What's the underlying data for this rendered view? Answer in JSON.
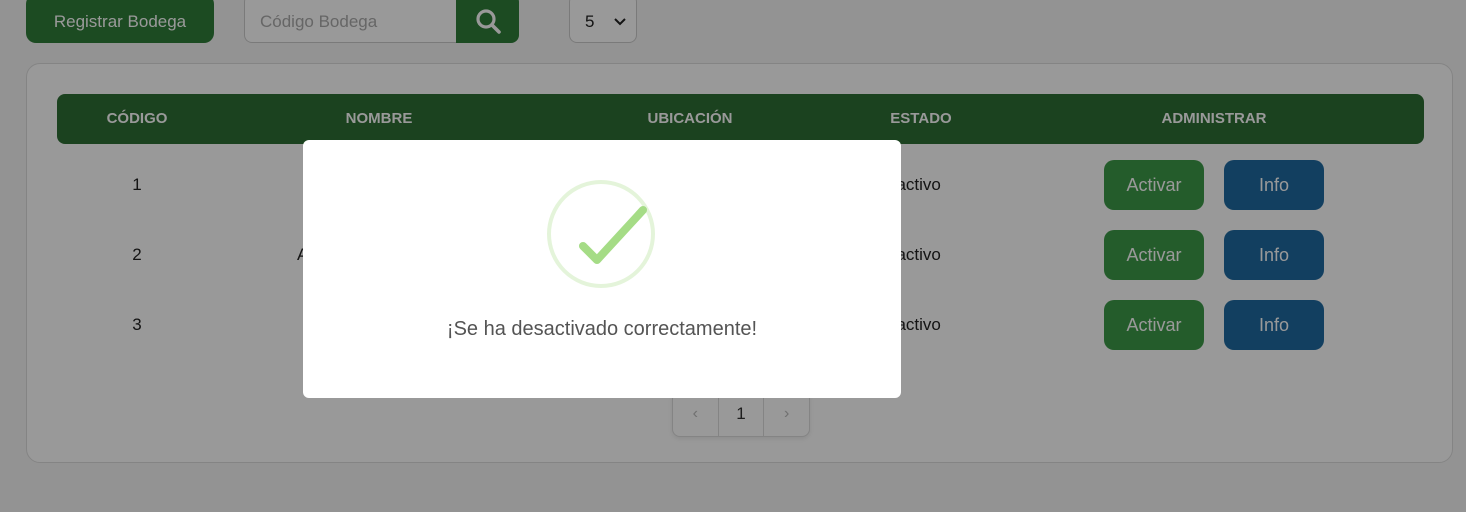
{
  "toolbar": {
    "register_label": "Registrar Bodega",
    "search_placeholder": "Código Bodega",
    "page_size_value": "5"
  },
  "table": {
    "headers": [
      "CÓDIGO",
      "NOMBRE",
      "UBICACIÓN",
      "ESTADO",
      "ADMINISTRAR"
    ],
    "rows": [
      {
        "codigo": "1",
        "nombre": "",
        "ubicacion": "",
        "estado": "nactivo",
        "activate": "Activar",
        "info": "Info"
      },
      {
        "codigo": "2",
        "nombre": "A",
        "ubicacion": "",
        "estado": "nactivo",
        "activate": "Activar",
        "info": "Info"
      },
      {
        "codigo": "3",
        "nombre": "",
        "ubicacion": "",
        "estado": "nactivo",
        "activate": "Activar",
        "info": "Info"
      }
    ]
  },
  "pagination": {
    "prev": "‹",
    "current": "1",
    "next": "›"
  },
  "modal": {
    "icon": "success-check-icon",
    "message": "¡Se ha desactivado correctamente!"
  },
  "colors": {
    "primary_green": "#2f7d3a",
    "header_green": "#2e6e35",
    "activate_green": "#3d9a48",
    "info_blue": "#1f6aa0",
    "success_check": "#a5dc86"
  }
}
